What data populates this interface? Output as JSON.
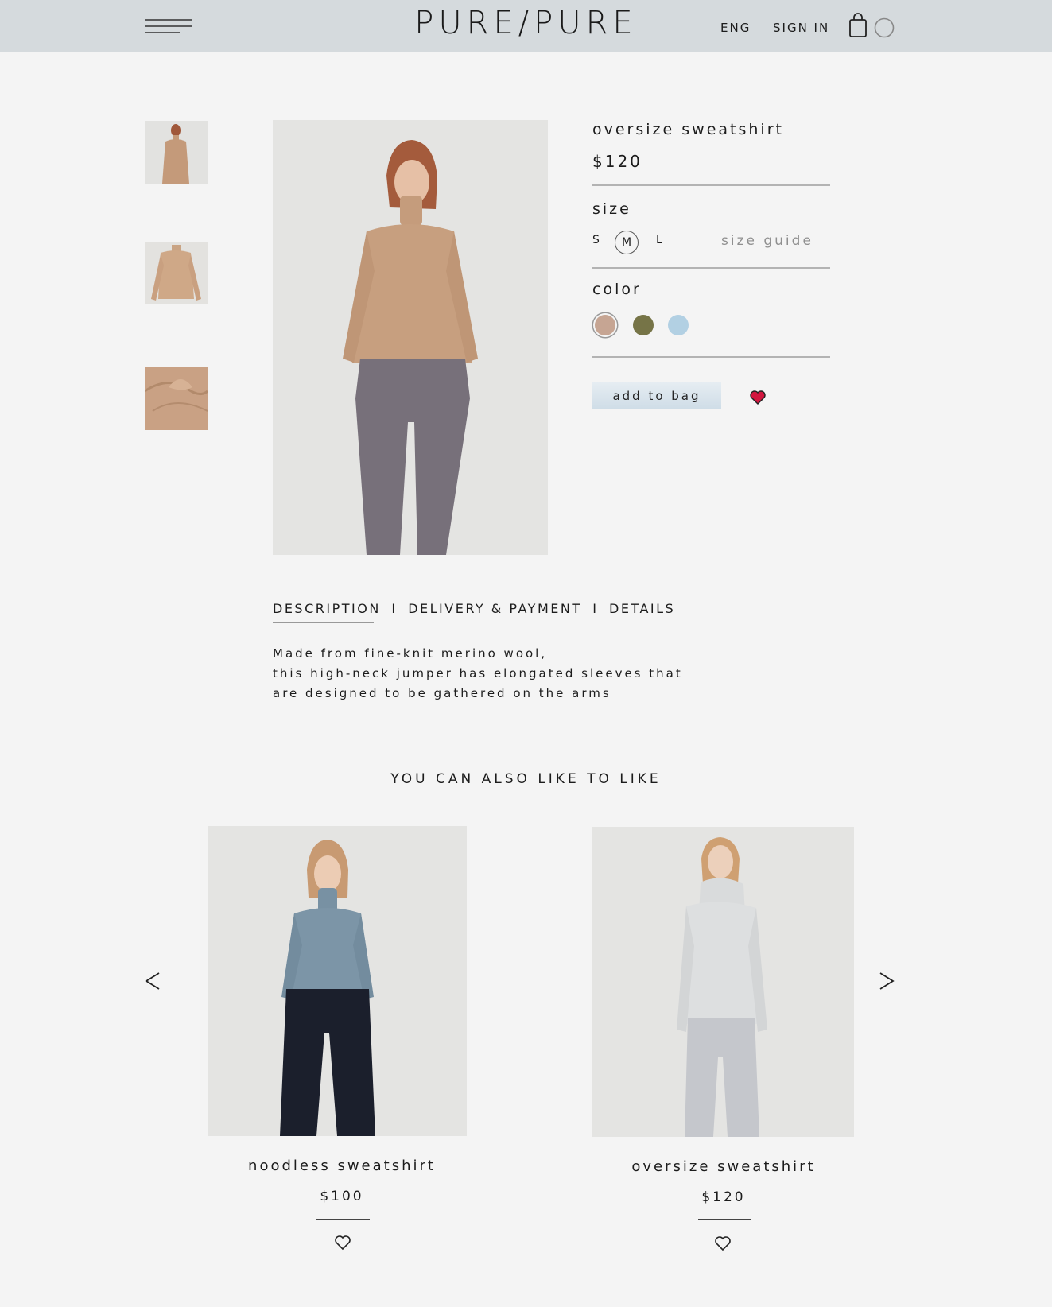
{
  "header": {
    "logo_left": "PURE",
    "logo_sep": "/",
    "logo_right": "PURE",
    "lang": "ENG",
    "sign_in": "SIGN IN"
  },
  "product": {
    "title": "oversize sweatshirt",
    "price": "$120",
    "size_label": "size",
    "sizes": [
      "S",
      "M",
      "L"
    ],
    "selected_size": "M",
    "size_guide": "size guide",
    "color_label": "color",
    "colors": [
      "#c6a593",
      "#767447",
      "#b2d0e3"
    ],
    "selected_color": "#c6a593",
    "add_to_bag": "add to bag"
  },
  "tabs": {
    "description": "DESCRIPTION",
    "delivery": "DELIVERY & PAYMENT",
    "details": "DETAILS",
    "separator": "I"
  },
  "description": {
    "line1": "Made from fine-knit merino wool,",
    "line2": "this high-neck jumper has elongated sleeves that",
    "line3": "are designed to be gathered on the arms"
  },
  "recommendations": {
    "heading": "YOU CAN ALSO LIKE TO LIKE",
    "prev": "<",
    "next": ">",
    "items": [
      {
        "name": "noodless sweatshirt",
        "price": "$100"
      },
      {
        "name": "oversize sweatshirt",
        "price": "$120"
      }
    ]
  }
}
